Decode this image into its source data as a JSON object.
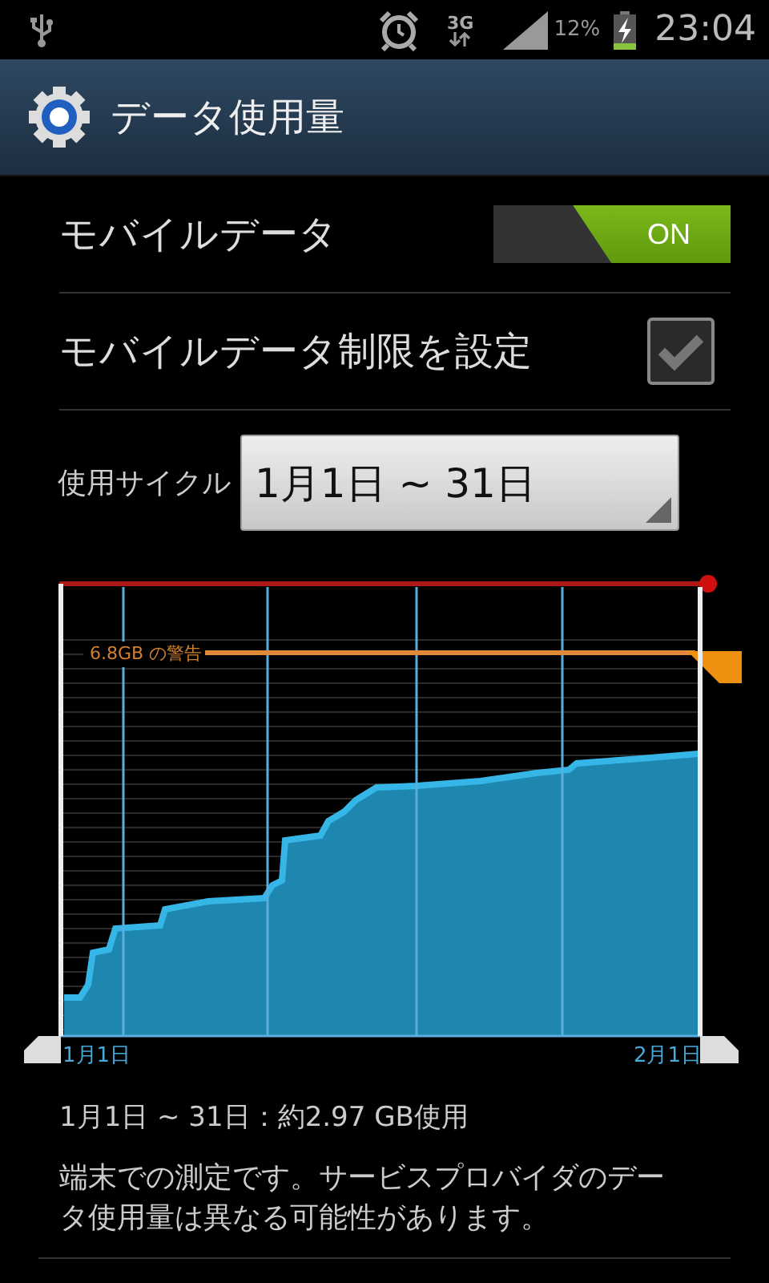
{
  "status_bar": {
    "network": "3G",
    "battery": "12%",
    "time": "23:04"
  },
  "title_bar": {
    "title": "データ使用量"
  },
  "settings": [
    {
      "kind": "toggle",
      "label": "モバイルデータ",
      "on": true,
      "toggle_label": "ON"
    },
    {
      "kind": "checkbox",
      "label": "モバイルデータ制限を設定",
      "checked": true
    }
  ],
  "cycle": {
    "label": "使用サイクル",
    "value": "1月1日 ~ 31日"
  },
  "chart": {
    "warning_label": "6.8GB の警告",
    "start_label": "1月1日",
    "end_label": "2月1日"
  },
  "summary": "1月1日 ~ 31日：約2.97 GB使用",
  "note": "端末での測定です。サービスプロバイダのデータ使用量は異なる可能性があります。"
}
